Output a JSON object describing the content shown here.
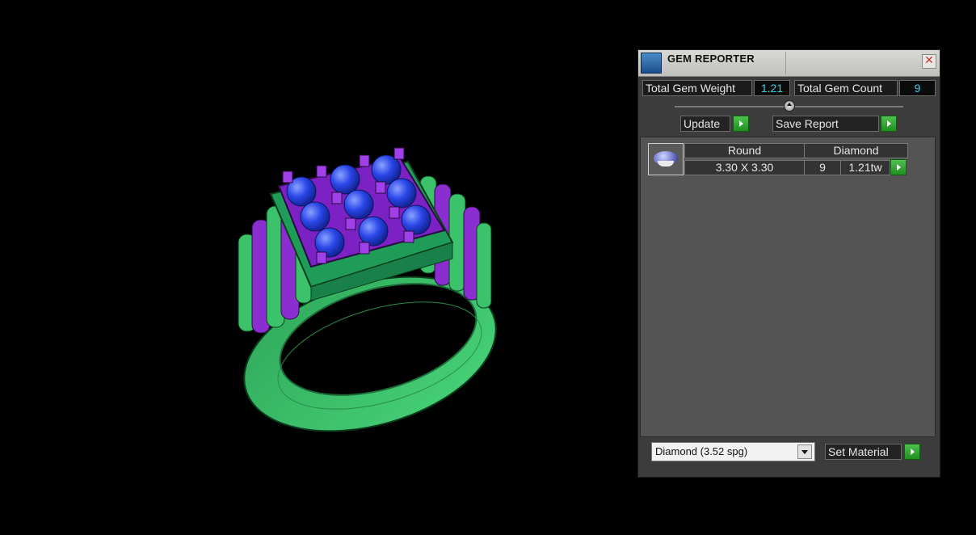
{
  "gem_reporter": {
    "title": "GEM REPORTER",
    "close_icon": "✕",
    "total_weight_label": "Total Gem Weight",
    "total_weight_value": "1.21",
    "total_count_label": "Total Gem Count",
    "total_count_value": "9",
    "update_label": "Update",
    "save_report_label": "Save Report",
    "table": {
      "header": [
        "Round",
        "Diamond"
      ],
      "row": {
        "size": "3.30 X 3.30",
        "count": "9",
        "weight": "1.21tw"
      }
    },
    "material_select": {
      "selected": "Diamond     (3.52 spg)"
    },
    "set_material_label": "Set Material"
  },
  "viewport": {
    "model": "ring",
    "colors": {
      "band": "#3bc26a",
      "prongs": "#8a2ed0",
      "gems": "#1f3ee0",
      "background": "#000000"
    }
  }
}
